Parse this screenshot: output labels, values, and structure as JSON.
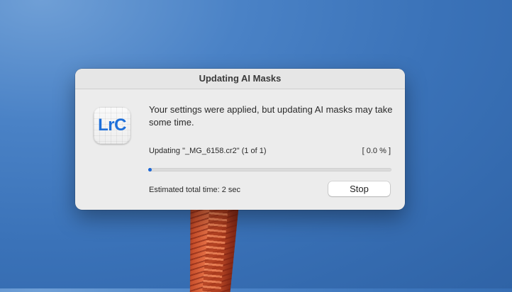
{
  "dialog": {
    "title": "Updating AI Masks",
    "app_icon": {
      "name": "lightroom-classic-app-icon",
      "label": "LrC",
      "color": "#1e6fd9"
    },
    "message": "Your settings were applied, but updating AI masks may take some time.",
    "status_text": "Updating \"_MG_6158.cr2\" (1 of 1)",
    "percent_text": "[ 0.0 % ]",
    "progress": {
      "fraction": 0.0,
      "fill_color": "#1a66d6"
    },
    "estimate_text": "Estimated total time: 2 sec",
    "stop_label": "Stop"
  },
  "colors": {
    "desktop_background": "#3a72b8",
    "dialog_background": "#ececec",
    "accent": "#1a66d6"
  }
}
